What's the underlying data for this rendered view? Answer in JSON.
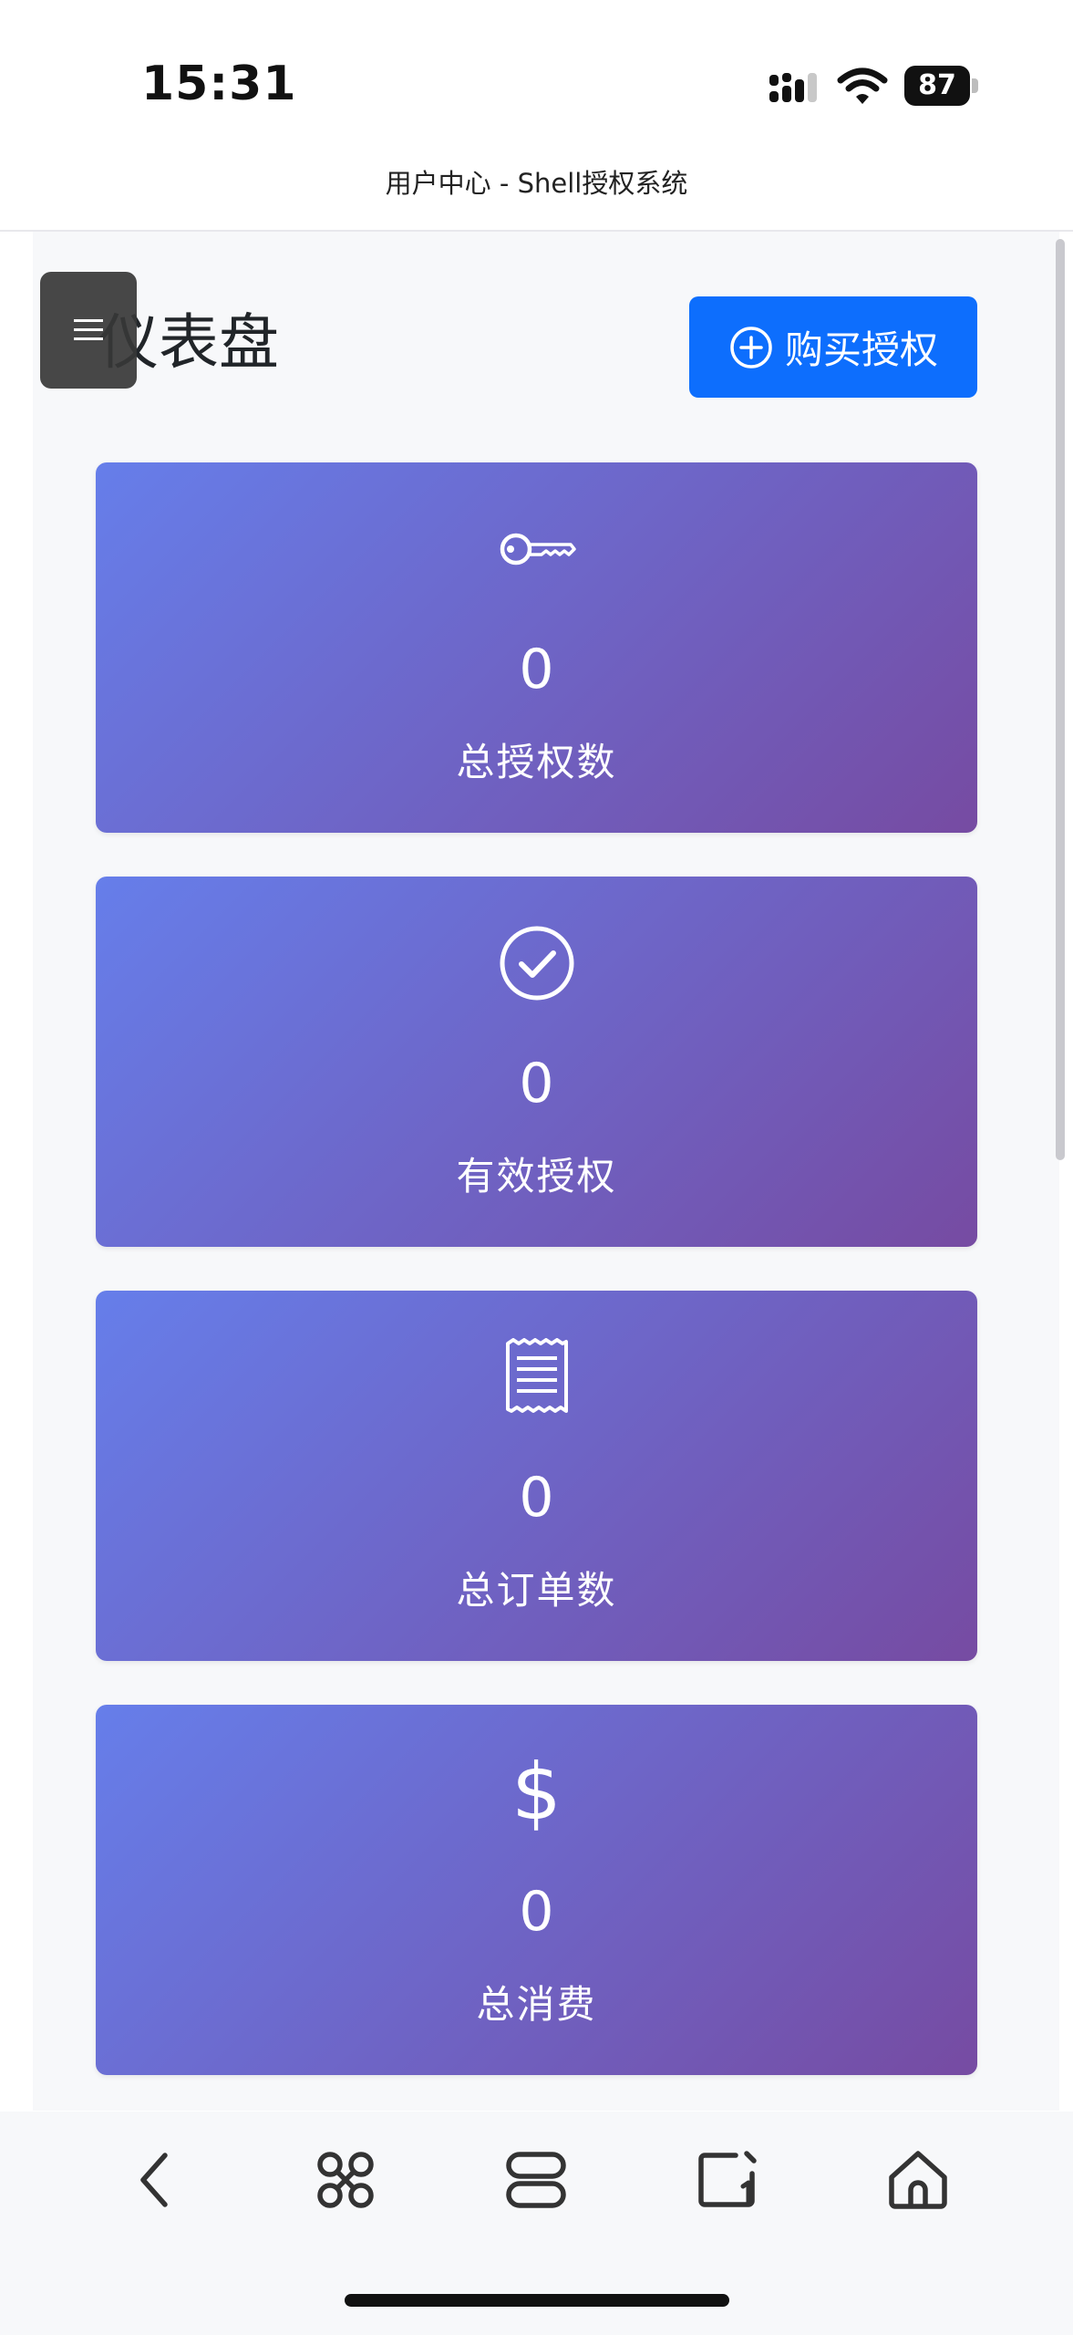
{
  "status_bar": {
    "time": "15:31",
    "battery": "87"
  },
  "page": {
    "title": "用户中心 - Shell授权系统",
    "heading": "仪表盘"
  },
  "actions": {
    "buy_label": "购买授权"
  },
  "stats": [
    {
      "icon": "key-icon",
      "value": "0",
      "label": "总授权数"
    },
    {
      "icon": "check-circle-icon",
      "value": "0",
      "label": "有效授权"
    },
    {
      "icon": "receipt-icon",
      "value": "0",
      "label": "总订单数"
    },
    {
      "icon": "dollar-icon",
      "value": "$",
      "label": "总消费",
      "amount": "0"
    }
  ],
  "colors": {
    "primary": "#0d6efd",
    "gradient_start": "#667eea",
    "gradient_end": "#764ba2"
  }
}
